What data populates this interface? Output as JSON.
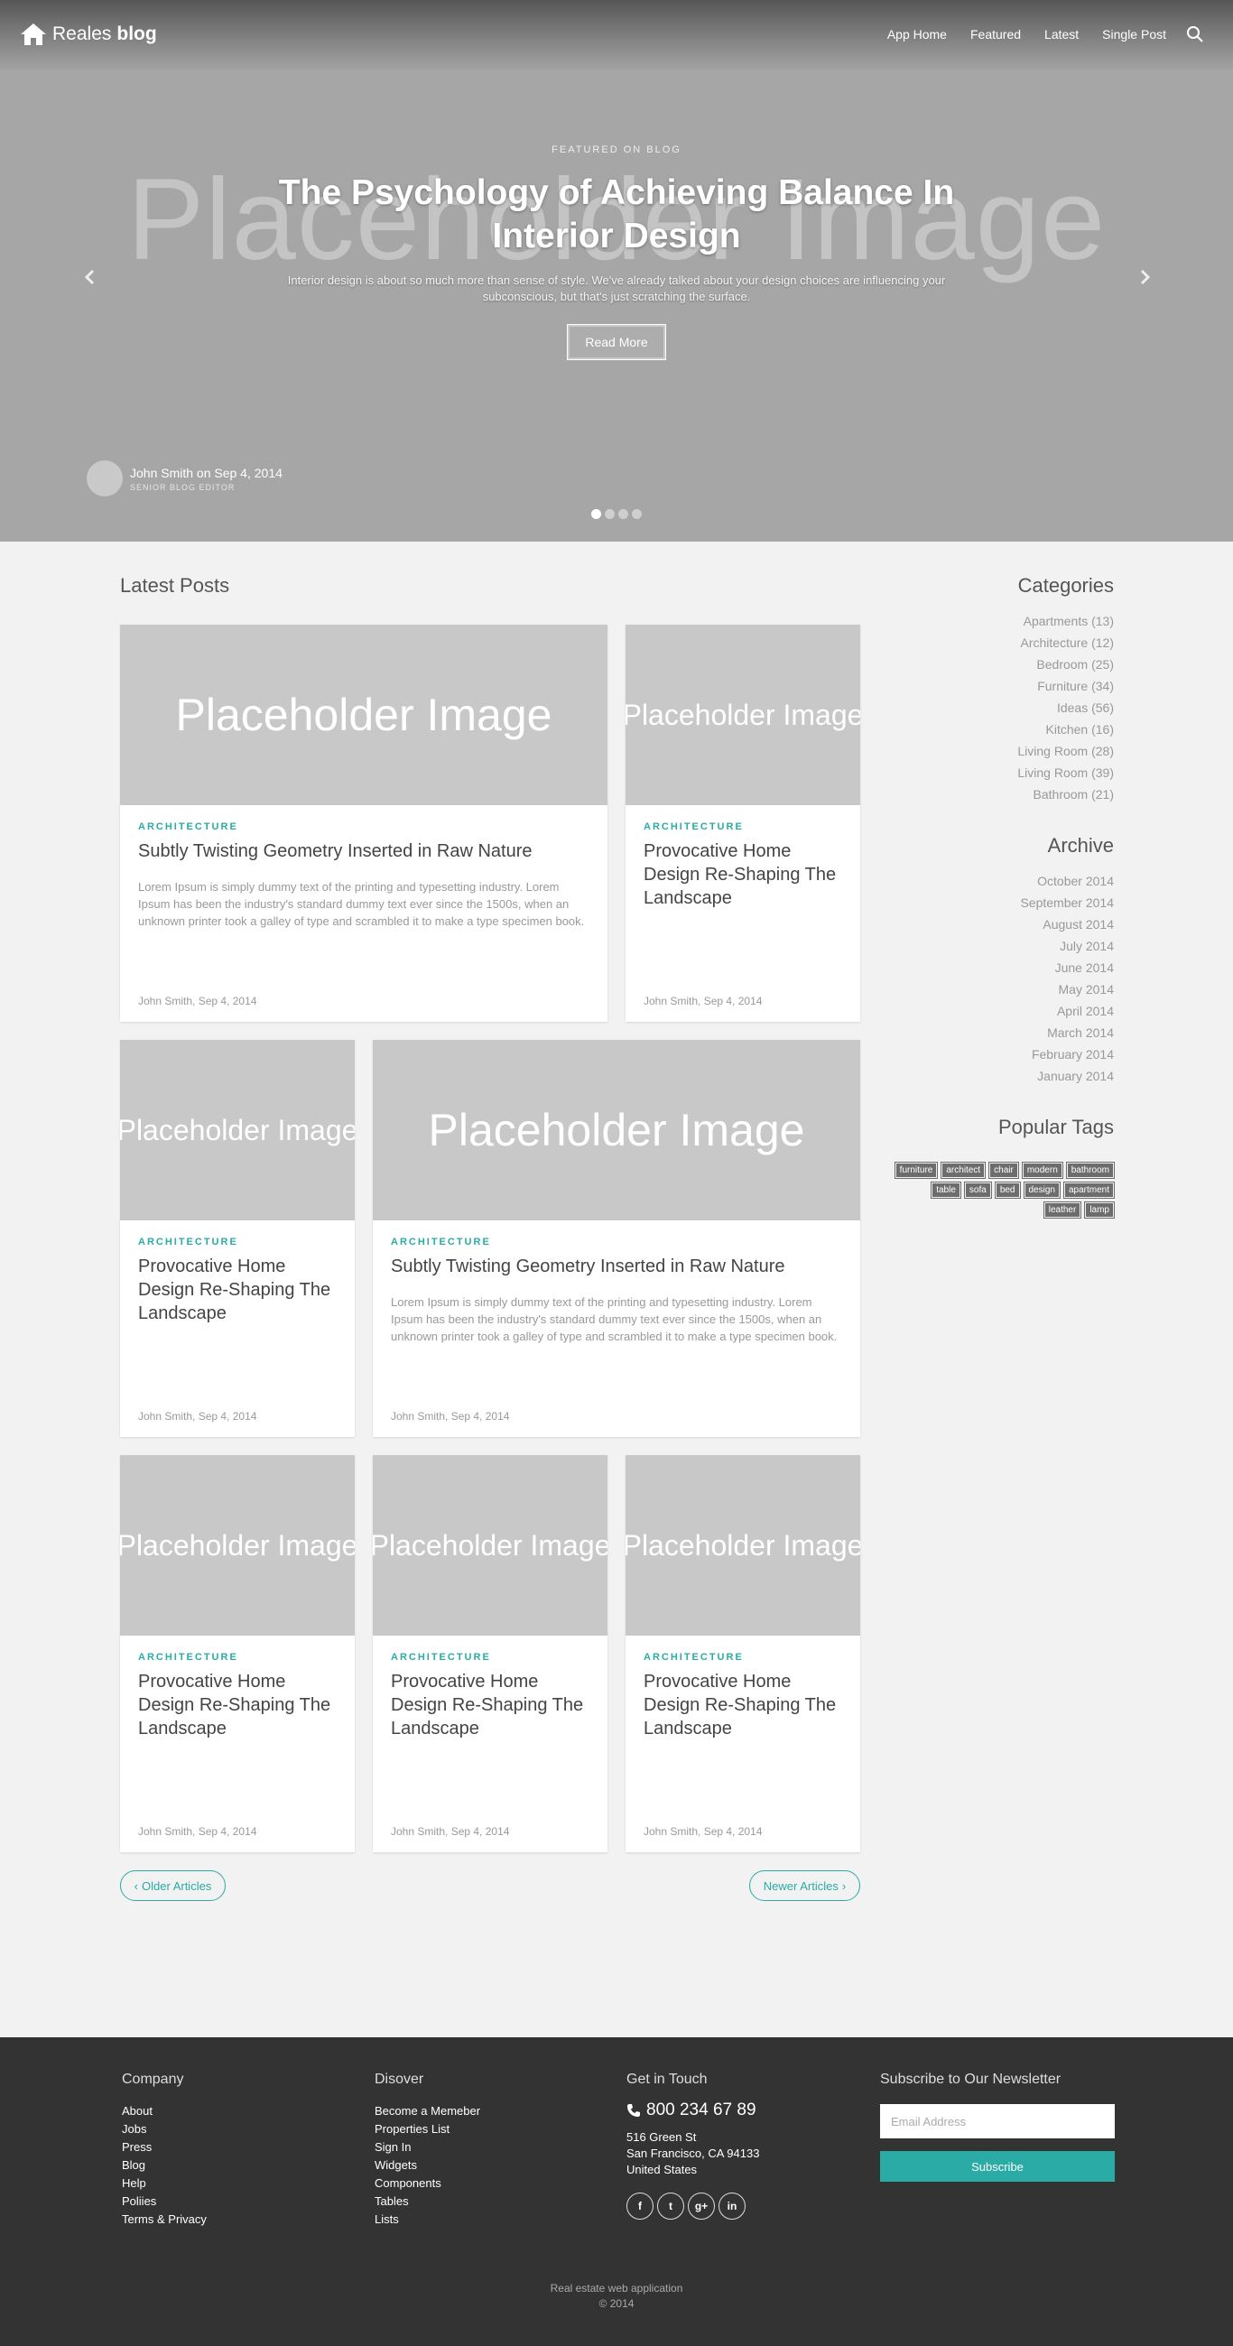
{
  "nav": {
    "brand_light": "Reales",
    "brand_bold": "blog",
    "links": [
      "App Home",
      "Featured",
      "Latest",
      "Single Post"
    ]
  },
  "hero": {
    "placeholder": "Placeholder Image",
    "kicker": "FEATURED ON BLOG",
    "title": "The Psychology of Achieving Balance In Interior Design",
    "description": "Interior design is about so much more than sense of style. We've already talked about your design choices are influencing your subconscious, but that's just scratching the surface.",
    "button": "Read More",
    "author": "John Smith on Sep 4, 2014",
    "author_role": "SENIOR BLOG EDITOR",
    "slide_count": 4,
    "active_slide": 1
  },
  "main": {
    "title": "Latest Posts",
    "posts": [
      {
        "image": "Placeholder Image",
        "category": "ARCHITECTURE",
        "title": "Subtly Twisting Geometry Inserted in Raw Nature",
        "excerpt": "Lorem Ipsum is simply dummy text of the printing and typesetting industry. Lorem Ipsum has been the industry's standard dummy text ever since the 1500s, when an unknown printer took a galley of type and scrambled it to make a type specimen book.",
        "meta": "John Smith, Sep 4, 2014"
      },
      {
        "image": "Placeholder Image",
        "category": "ARCHITECTURE",
        "title": "Provocative Home Design Re-Shaping The Landscape",
        "meta": "John Smith, Sep 4, 2014"
      },
      {
        "image": "Placeholder Image",
        "category": "ARCHITECTURE",
        "title": "Provocative Home Design Re-Shaping The Landscape",
        "meta": "John Smith, Sep 4, 2014"
      },
      {
        "image": "Placeholder Image",
        "category": "ARCHITECTURE",
        "title": "Subtly Twisting Geometry Inserted in Raw Nature",
        "excerpt": "Lorem Ipsum is simply dummy text of the printing and typesetting industry. Lorem Ipsum has been the industry's standard dummy text ever since the 1500s, when an unknown printer took a galley of type and scrambled it to make a type specimen book.",
        "meta": "John Smith, Sep 4, 2014"
      },
      {
        "image": "Placeholder Image",
        "category": "ARCHITECTURE",
        "title": "Provocative Home Design Re-Shaping The Landscape",
        "meta": "John Smith, Sep 4, 2014"
      },
      {
        "image": "Placeholder Image",
        "category": "ARCHITECTURE",
        "title": "Provocative Home Design Re-Shaping The Landscape",
        "meta": "John Smith, Sep 4, 2014"
      },
      {
        "image": "Placeholder Image",
        "category": "ARCHITECTURE",
        "title": "Provocative Home Design Re-Shaping The Landscape",
        "meta": "John Smith, Sep 4, 2014"
      }
    ],
    "older": "Older Articles",
    "newer": "Newer Articles"
  },
  "sidebar": {
    "categories_title": "Categories",
    "categories": [
      "Apartments (13)",
      "Architecture (12)",
      "Bedroom (25)",
      "Furniture (34)",
      "Ideas (56)",
      "Kitchen (16)",
      "Living Room (28)",
      "Living Room (39)",
      "Bathroom (21)"
    ],
    "archive_title": "Archive",
    "archive": [
      "October 2014",
      "September 2014",
      "August 2014",
      "July 2014",
      "June 2014",
      "May 2014",
      "April 2014",
      "March 2014",
      "February 2014",
      "January 2014"
    ],
    "tags_title": "Popular Tags",
    "tags": [
      "furniture",
      "architect",
      "chair",
      "modern",
      "bathroom",
      "table",
      "sofa",
      "bed",
      "design",
      "apartment",
      "leather",
      "lamp"
    ]
  },
  "footer": {
    "company_title": "Company",
    "company": [
      "About",
      "Jobs",
      "Press",
      "Blog",
      "Help",
      "Poliies",
      "Terms & Privacy"
    ],
    "discover_title": "Disover",
    "discover": [
      "Become a Memeber",
      "Properties List",
      "Sign In",
      "Widgets",
      "Components",
      "Tables",
      "Lists"
    ],
    "contact_title": "Get in Touch",
    "phone": "800 234 67 89",
    "address": [
      "516 Green St",
      "San Francisco, CA 94133",
      "United States"
    ],
    "socials": [
      "f",
      "t",
      "g+",
      "in"
    ],
    "newsletter_title": "Subscribe to Our Newsletter",
    "email_placeholder": "Email Address",
    "subscribe": "Subscribe",
    "copyright_line1": "Real estate web application",
    "copyright_line2": "© 2014"
  },
  "colors": {
    "accent": "#2aaba5",
    "footer": "#333333",
    "hero": "#a6a6a6"
  }
}
